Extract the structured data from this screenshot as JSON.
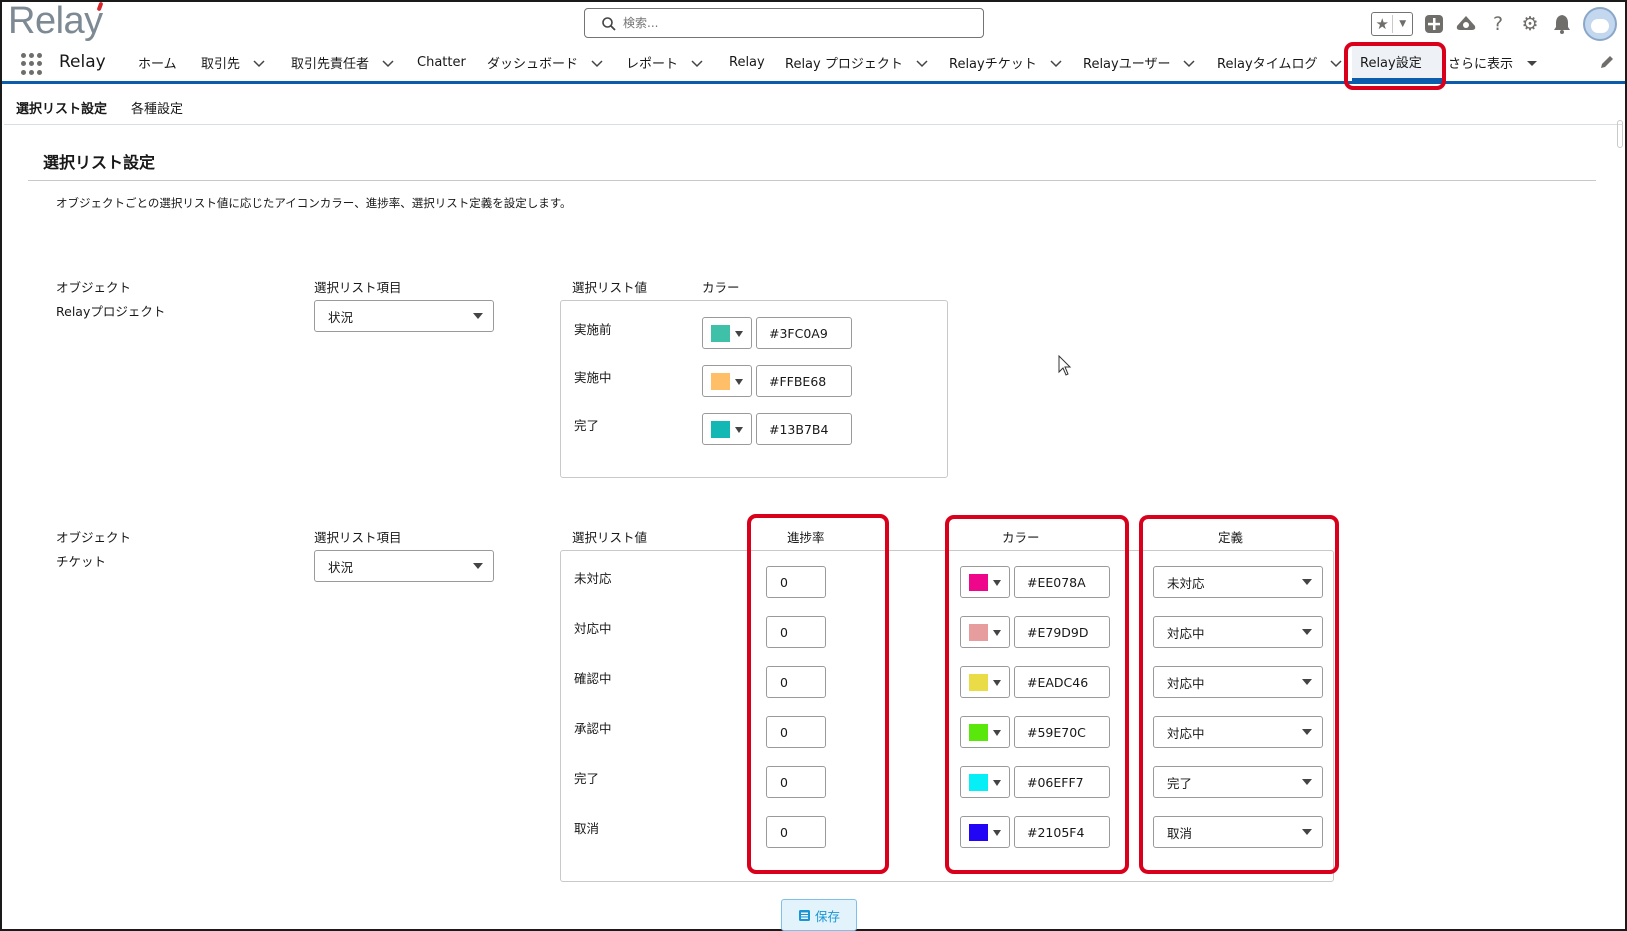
{
  "header": {
    "logo": "Relay",
    "search_placeholder": "検索..."
  },
  "nav": {
    "app_name": "Relay",
    "items": [
      {
        "label": "ホーム"
      },
      {
        "label": "取引先"
      },
      {
        "label": "取引先責任者"
      },
      {
        "label": "Chatter"
      },
      {
        "label": "ダッシュボード"
      },
      {
        "label": "レポート"
      },
      {
        "label": "Relay"
      },
      {
        "label": "Relay プロジェクト"
      },
      {
        "label": "Relayチケット"
      },
      {
        "label": "Relayユーザー"
      },
      {
        "label": "Relayタイムログ"
      },
      {
        "label": "Relay設定"
      },
      {
        "label": "さらに表示"
      }
    ]
  },
  "subtabs": [
    "選択リスト設定",
    "各種設定"
  ],
  "page": {
    "title": "選択リスト設定",
    "description": "オブジェクトごとの選択リスト値に応じたアイコンカラー、進捗率、選択リスト定義を設定します。"
  },
  "labels": {
    "object": "オブジェクト",
    "picklist_field": "選択リスト項目",
    "picklist_value": "選択リスト値",
    "color": "カラー",
    "progress": "進捗率",
    "definition": "定義"
  },
  "project_block": {
    "object_name": "Relayプロジェクト",
    "field": "状況",
    "rows": [
      {
        "value": "実施前",
        "color": "#3FC0A9",
        "hex": "#3FC0A9"
      },
      {
        "value": "実施中",
        "color": "#FFBE68",
        "hex": "#FFBE68"
      },
      {
        "value": "完了",
        "color": "#13B7B4",
        "hex": "#13B7B4"
      }
    ]
  },
  "ticket_block": {
    "object_name": "チケット",
    "field": "状況",
    "rows": [
      {
        "value": "未対応",
        "progress": "0",
        "color": "#EE078A",
        "hex": "#EE078A",
        "definition": "未対応"
      },
      {
        "value": "対応中",
        "progress": "0",
        "color": "#E79D9D",
        "hex": "#E79D9D",
        "definition": "対応中"
      },
      {
        "value": "確認中",
        "progress": "0",
        "color": "#EADC46",
        "hex": "#EADC46",
        "definition": "対応中"
      },
      {
        "value": "承認中",
        "progress": "0",
        "color": "#59E70C",
        "hex": "#59E70C",
        "definition": "対応中"
      },
      {
        "value": "完了",
        "progress": "0",
        "color": "#06EFF7",
        "hex": "#06EFF7",
        "definition": "完了"
      },
      {
        "value": "取消",
        "progress": "0",
        "color": "#2105F4",
        "hex": "#2105F4",
        "definition": "取消"
      }
    ]
  },
  "actions": {
    "save": "保存"
  },
  "colors": {
    "accent": "#0b5cab",
    "highlight": "#d9001b"
  }
}
